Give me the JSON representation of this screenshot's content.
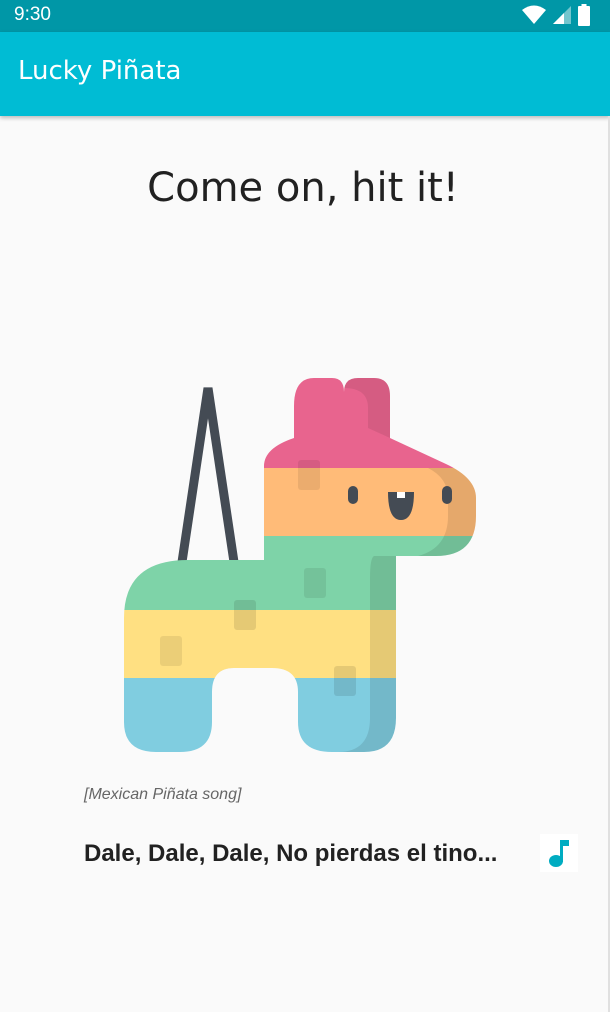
{
  "status_bar": {
    "time": "9:30"
  },
  "app_bar": {
    "title": "Lucky Piñata"
  },
  "main": {
    "heading": "Come on, hit it!",
    "caption": "[Mexican Piñata song]",
    "lyric": "Dale, Dale, Dale, No pierdas el tino..."
  },
  "colors": {
    "status_bar": "#0097a7",
    "app_bar": "#00bcd4",
    "accent": "#00acc1",
    "pink": "#e8648e",
    "orange": "#ffbb78",
    "green": "#7ed3a8",
    "yellow": "#ffe082",
    "blue": "#80cde0",
    "string": "#444b54"
  },
  "icons": {
    "status": [
      "wifi-icon",
      "cell-signal-icon",
      "battery-icon"
    ],
    "music": "music-note-icon"
  }
}
